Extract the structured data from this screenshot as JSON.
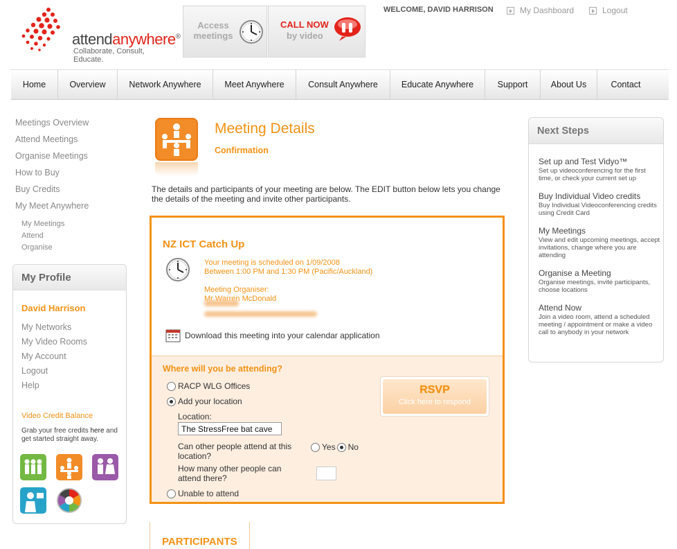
{
  "brand": {
    "logo_prefix": "attend",
    "logo_suffix": "anywhere",
    "logo_mark": "®",
    "tagline": "Collaborate, Consult, Educate."
  },
  "header": {
    "access_label": "Access meetings",
    "call_title": "CALL NOW",
    "call_sub": "by video",
    "welcome": "WELCOME, DAVID HARRISON",
    "dashboard_link": "My Dashboard",
    "logout_link": "Logout"
  },
  "nav": {
    "items": [
      {
        "label": "Home"
      },
      {
        "label": "Overview"
      },
      {
        "label": "Network Anywhere"
      },
      {
        "label": "Meet Anywhere"
      },
      {
        "label": "Consult Anywhere"
      },
      {
        "label": "Educate Anywhere"
      },
      {
        "label": "Support"
      },
      {
        "label": "About Us"
      },
      {
        "label": "Contact"
      }
    ]
  },
  "left_nav": {
    "items": [
      {
        "label": "Meetings Overview"
      },
      {
        "label": "Attend Meetings"
      },
      {
        "label": "Organise Meetings"
      },
      {
        "label": "How to Buy"
      },
      {
        "label": "Buy Credits"
      },
      {
        "label": "My Meet Anywhere"
      }
    ],
    "sub_items": [
      {
        "label": "My Meetings"
      },
      {
        "label": "Attend"
      },
      {
        "label": "Organise"
      }
    ]
  },
  "profile": {
    "title": "My Profile",
    "name": "David Harrison",
    "links": [
      {
        "label": "My Networks"
      },
      {
        "label": "My Video Rooms"
      },
      {
        "label": "My Account"
      },
      {
        "label": "Logout"
      },
      {
        "label": "Help"
      }
    ],
    "credit_title": "Video Credit Balance",
    "credit_text_before": "Grab your free credits ",
    "credit_link": "here",
    "credit_text_after": " and get started straight away."
  },
  "page": {
    "title": "Meeting Details",
    "subtitle": "Confirmation",
    "intro": "The details and participants of your meeting are below. The EDIT button below lets you change the details of the meeting and invite other participants."
  },
  "meeting": {
    "title": "NZ ICT Catch Up",
    "schedule_line1": "Your meeting is scheduled on 1/09/2008",
    "schedule_line2": "Between 1:00 PM and 1:30 PM (Pacific/Auckland)",
    "organiser_label": "Meeting Organiser:",
    "organiser_name": "Mr Warren McDonald",
    "download_link": "Download",
    "download_text": "this meeting into your calendar application"
  },
  "attendance": {
    "question": "Where will you be attending?",
    "option_office": "RACP WLG Offices",
    "option_add_location": "Add your location",
    "location_label": "Location:",
    "location_value": "The StressFree bat cave",
    "others_question": "Can other people attend at this location?",
    "yes_label": "Yes",
    "no_label": "No",
    "how_many_question": "How many other people can attend there?",
    "option_unable": "Unable to attend",
    "rsvp_title": "RSVP",
    "rsvp_sub": "Click here to respond"
  },
  "participants": {
    "title": "PARTICIPANTS"
  },
  "next_steps": {
    "title": "Next Steps",
    "items": [
      {
        "label": "Set up and Test Vidyo™",
        "desc": "Set up videoconferencing for the first time, or check your current set up"
      },
      {
        "label": "Buy Individual Video credits",
        "desc": "Buy Individual Videoconferencing credits using Credit Card"
      },
      {
        "label": "My Meetings",
        "desc": "View and edit upcoming meetings, accept invitations, change where you are attending"
      },
      {
        "label": "Organise a Meeting",
        "desc": "Organise meetings, invite participants, choose locations"
      },
      {
        "label": "Attend Now",
        "desc": "Join a video room, attend a scheduled meeting / appointment or make a video call to anybody in your network"
      }
    ]
  },
  "colors": {
    "brand_red": "#e2231a",
    "accent_orange": "#f39214",
    "attend_bg": "#fdeee0"
  },
  "icons": [
    "logo-dots-icon",
    "clock-icon",
    "call-now-icon",
    "meeting-icon",
    "calendar-icon",
    "play-bullet-icon",
    "network-icon",
    "meet-icon",
    "consult-icon",
    "educate-icon",
    "color-wheel-icon"
  ]
}
